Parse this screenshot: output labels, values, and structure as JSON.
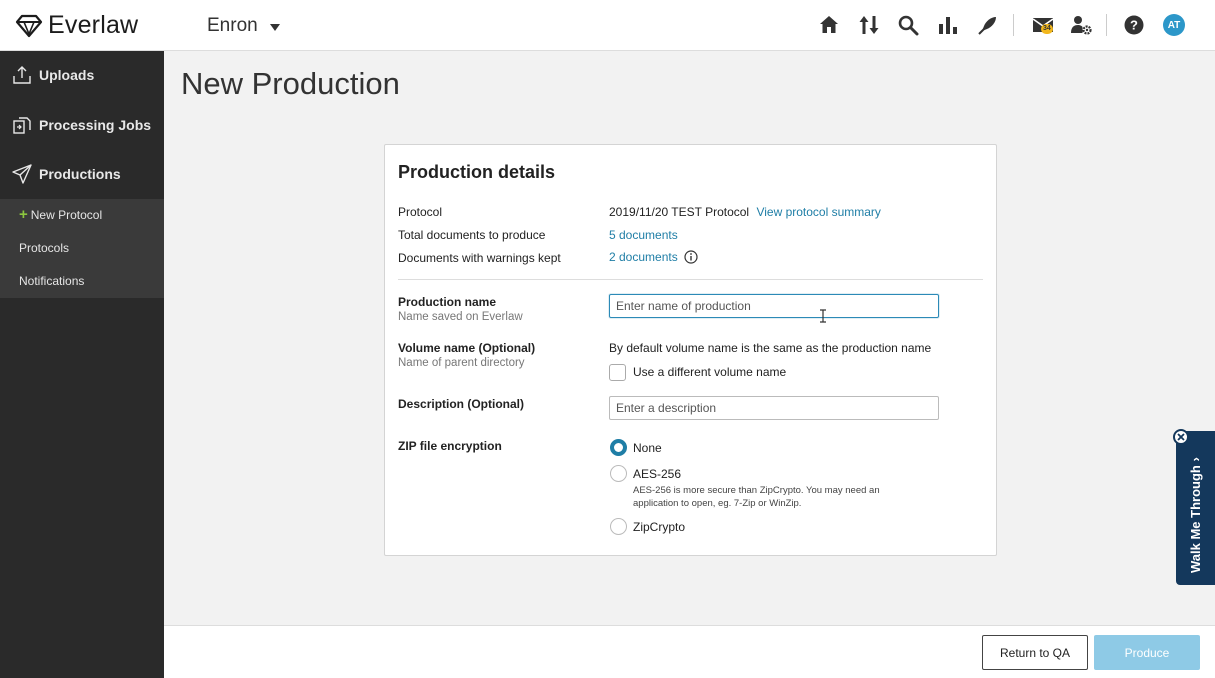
{
  "header": {
    "logo_text": "Everlaw",
    "project_name": "Enron",
    "mail_count": "34",
    "avatar_initials": "AT",
    "icons": [
      "home-icon",
      "sort-icon",
      "search-icon",
      "bar-chart-icon",
      "pen-icon",
      "mail-icon",
      "user-gear-icon",
      "help-icon"
    ]
  },
  "sidebar": {
    "items": [
      {
        "label": "Uploads",
        "icon": "upload-icon"
      },
      {
        "label": "Processing Jobs",
        "icon": "processing-icon"
      },
      {
        "label": "Productions",
        "icon": "send-icon"
      }
    ],
    "sub_items": [
      {
        "label": "New Protocol",
        "prefix": "+"
      },
      {
        "label": "Protocols"
      },
      {
        "label": "Notifications"
      }
    ]
  },
  "page": {
    "title": "New Production"
  },
  "card": {
    "title": "Production details",
    "protocol_label": "Protocol",
    "protocol_value": "2019/11/20 TEST Protocol",
    "protocol_link": "View protocol summary",
    "total_docs_label": "Total documents to produce",
    "total_docs_value": "5 documents",
    "warnings_label": "Documents with warnings kept",
    "warnings_value": "2 documents",
    "production_name_label": "Production name",
    "production_name_sub": "Name saved on Everlaw",
    "production_name_placeholder": "Enter name of production",
    "volume_name_label": "Volume name (Optional)",
    "volume_name_sub": "Name of parent directory",
    "volume_default_text": "By default volume name is the same as the production name",
    "volume_checkbox_label": "Use a different volume name",
    "description_label": "Description (Optional)",
    "description_placeholder": "Enter a description",
    "zip_label": "ZIP file encryption",
    "zip_options": [
      {
        "label": "None",
        "selected": true
      },
      {
        "label": "AES-256",
        "selected": false
      },
      {
        "label": "ZipCrypto",
        "selected": false
      }
    ],
    "aes_help": "AES-256 is more secure than ZipCrypto. You may need an application to open, eg. 7-Zip or WinZip."
  },
  "footer": {
    "return_label": "Return to QA",
    "produce_label": "Produce"
  },
  "walkme": {
    "label": "Walk Me Through"
  },
  "colors": {
    "accent": "#1f7ea6",
    "sidebar_bg": "#2a2a2a",
    "produce_button": "#8ecae6",
    "walkme_bg": "#14385c"
  }
}
